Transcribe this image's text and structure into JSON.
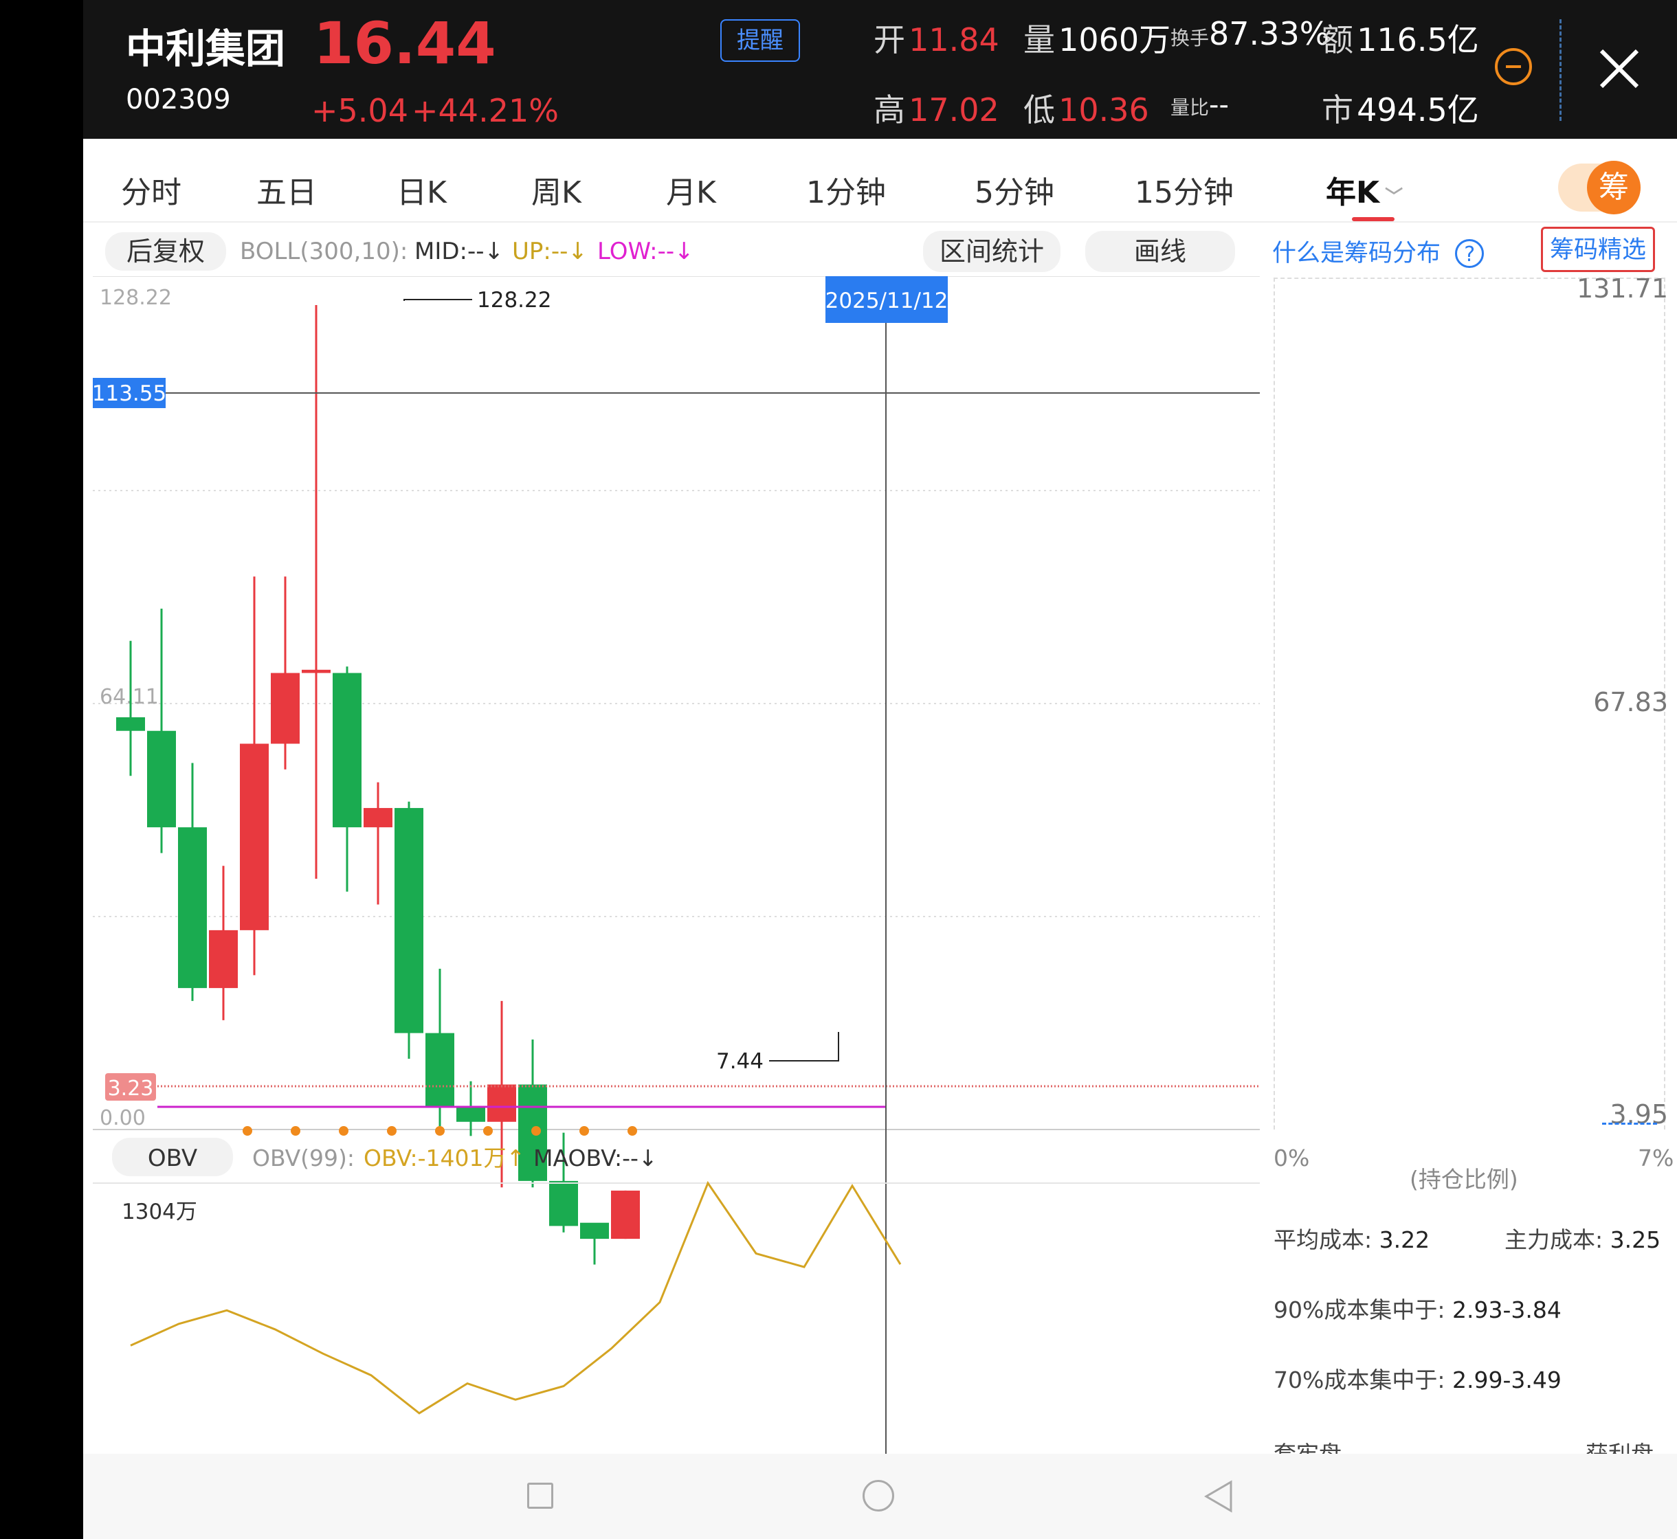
{
  "header": {
    "name": "中利集团",
    "code": "002309",
    "price": "16.44",
    "change": "+5.04",
    "change_pct": "+44.21%",
    "alert_btn": "提醒",
    "open_lbl": "开",
    "open_val": "11.84",
    "vol_lbl": "量",
    "vol_val": "1060万",
    "turnover_lbl": "换手",
    "turnover_val": "87.33%",
    "amount_lbl": "额",
    "amount_val": "116.5亿",
    "high_lbl": "高",
    "high_val": "17.02",
    "low_lbl": "低",
    "low_val": "10.36",
    "volratio_lbl": "量比",
    "volratio_val": "--",
    "mcap_lbl": "市",
    "mcap_val": "494.5亿"
  },
  "tabs": [
    "分时",
    "五日",
    "日K",
    "周K",
    "月K",
    "1分钟",
    "5分钟",
    "15分钟",
    "年K"
  ],
  "active_tab": "年K",
  "chip_toggle": "筹",
  "toolbar": {
    "adj": "后复权",
    "boll_name": "BOLL(300,10):",
    "boll_mid": "MID:--↓",
    "boll_up": "UP:--↓",
    "boll_low": "LOW:--↓",
    "range_stats": "区间统计",
    "draw_line": "画线"
  },
  "colors": {
    "up": "#e8393f",
    "down": "#1aab50",
    "obv": "#d4a422",
    "low_band": "#cc22cc",
    "accent": "#2a7cf0"
  },
  "kchart": {
    "y_top_label": "128.22",
    "y_mid_label": "64.11",
    "y_bottom_label": "0.00",
    "crosshair_price": "113.55",
    "crosshair_date": "2025/11/12",
    "max_label": "128.22",
    "min_label": "7.44",
    "cost_line_label": "3.23"
  },
  "chart_data": {
    "type": "candlestick",
    "ylim": [
      0,
      128.22
    ],
    "candles": [
      {
        "o": 64.11,
        "c": 62.0,
        "h": 76.0,
        "l": 55.0
      },
      {
        "o": 62.0,
        "c": 47.0,
        "h": 81.0,
        "l": 43.0
      },
      {
        "o": 47.0,
        "c": 22.0,
        "h": 57.0,
        "l": 20.0
      },
      {
        "o": 22.0,
        "c": 31.0,
        "h": 41.0,
        "l": 17.0
      },
      {
        "o": 31.0,
        "c": 60.0,
        "h": 86.0,
        "l": 24.0
      },
      {
        "o": 60.0,
        "c": 71.0,
        "h": 86.0,
        "l": 56.0
      },
      {
        "o": 71.0,
        "c": 71.5,
        "h": 128.22,
        "l": 39.0
      },
      {
        "o": 71.0,
        "c": 47.0,
        "h": 72.0,
        "l": 37.0
      },
      {
        "o": 47.0,
        "c": 50.0,
        "h": 54.0,
        "l": 35.0
      },
      {
        "o": 50.0,
        "c": 15.0,
        "h": 51.0,
        "l": 11.0
      },
      {
        "o": 15.0,
        "c": 3.5,
        "h": 25.0,
        "l": -0.5
      },
      {
        "o": 3.5,
        "c": 1.2,
        "h": 7.5,
        "l": -1.0
      },
      {
        "o": 1.2,
        "c": 7.0,
        "h": 20.0,
        "l": -9.0
      },
      {
        "o": 7.0,
        "c": -8.0,
        "h": 14.0,
        "l": -9.0
      },
      {
        "o": -8.0,
        "c": -15.0,
        "h": -0.5,
        "l": -16.0
      },
      {
        "o": -14.5,
        "c": -17.0,
        "h": -16.0,
        "l": -21.0
      },
      {
        "o": -17.0,
        "c": -9.5,
        "h": -9.5,
        "l": -17.0
      }
    ],
    "volume_dots": 9
  },
  "obv": {
    "tag": "OBV",
    "params": "OBV(99):",
    "value": "OBV:-1401万↑",
    "maobv": "MAOBV:--↓",
    "top_label": "1304万",
    "series": [
      40,
      48,
      53,
      46,
      37,
      29,
      15,
      26,
      20,
      25,
      39,
      56,
      100,
      74,
      69,
      99,
      70
    ]
  },
  "chip": {
    "help_link": "什么是筹码分布",
    "help_icon": "?",
    "select_btn": "筹码精选",
    "y_top": "131.71",
    "y_mid": "67.83",
    "y_bottom": "3.95",
    "x_left": "0%",
    "x_right": "7%",
    "x_label": "(持仓比例)",
    "avg_cost_lbl": "平均成本:",
    "avg_cost_val": "3.22",
    "main_cost_lbl": "主力成本:",
    "main_cost_val": "3.25",
    "c90_lbl": "90%成本集中于:",
    "c90_val": "2.93-3.84",
    "c70_lbl": "70%成本集中于:",
    "c70_val": "2.99-3.49",
    "trapped_lbl": "套牢盘",
    "profit_lbl": "获利盘"
  }
}
